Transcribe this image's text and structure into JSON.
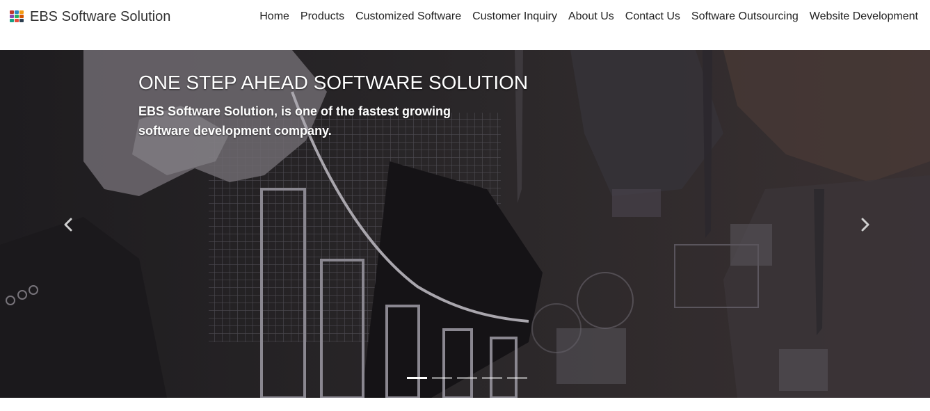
{
  "brand": {
    "name": "EBS Software Solution",
    "logo_colors": [
      "#c0392b",
      "#2e86c1",
      "#f39c12",
      "#8e44ad",
      "#27ae60",
      "#d35400",
      "#16a085",
      "#e74c3c",
      "#2c3e50"
    ]
  },
  "nav": {
    "items": [
      {
        "label": "Home"
      },
      {
        "label": "Products"
      },
      {
        "label": "Customized Software"
      },
      {
        "label": "Customer Inquiry"
      },
      {
        "label": "About Us"
      },
      {
        "label": "Contact Us"
      },
      {
        "label": "Software Outsourcing"
      },
      {
        "label": "Website Development"
      }
    ]
  },
  "hero": {
    "title": "ONE STEP AHEAD SOFTWARE SOLUTION",
    "subtitle": "EBS Software Solution, is one of the fastest growing software development company.",
    "prev_icon": "chevron-left-icon",
    "next_icon": "chevron-right-icon",
    "slide_count": 5,
    "active_slide": 1
  }
}
